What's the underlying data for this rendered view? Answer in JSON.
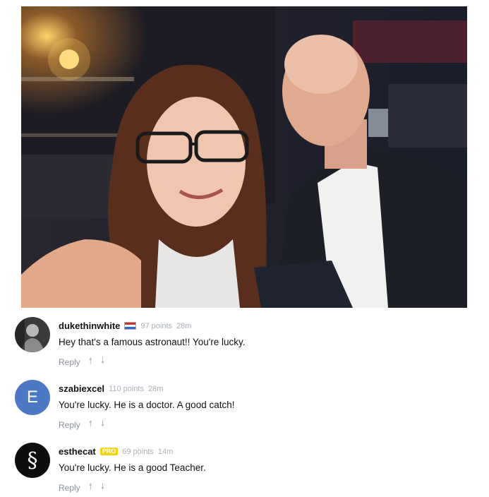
{
  "photo": {
    "icon": "selfie-photo"
  },
  "comments": [
    {
      "username": "dukethinwhite",
      "badge": "flag",
      "points": "97 points",
      "time": "28m",
      "text": "Hey that's a famous astronaut!! You're lucky.",
      "reply_label": "Reply",
      "avatar": {
        "type": "photo"
      }
    },
    {
      "username": "szabiexcel",
      "badge": "",
      "points": "110 points",
      "time": "28m",
      "text": "You're lucky. He is a doctor. A good catch!",
      "reply_label": "Reply",
      "avatar": {
        "type": "letter",
        "letter": "E",
        "color": "#4d79c4"
      }
    },
    {
      "username": "esthecat",
      "badge": "PRO",
      "points": "69 points",
      "time": "14m",
      "text": "You're lucky. He is a good Teacher.",
      "reply_label": "Reply",
      "avatar": {
        "type": "glyph",
        "letter": "§",
        "color": "#0d0d0d"
      }
    }
  ]
}
